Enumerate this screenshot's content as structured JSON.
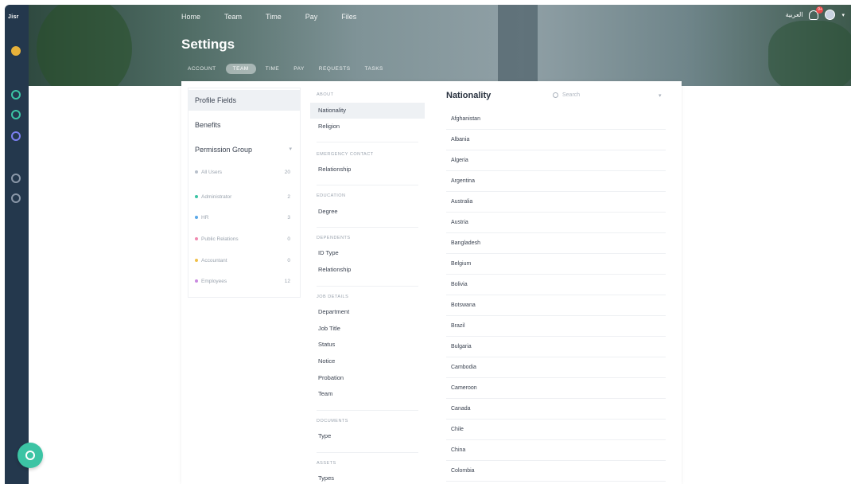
{
  "app": {
    "brand": "Jisr"
  },
  "topnav": [
    "Home",
    "Team",
    "Time",
    "Pay",
    "Files"
  ],
  "page_title": "Settings",
  "subtabs": [
    {
      "label": "ACCOUNT",
      "active": false
    },
    {
      "label": "TEAM",
      "active": true
    },
    {
      "label": "TIME",
      "active": false
    },
    {
      "label": "PAY",
      "active": false
    },
    {
      "label": "REQUESTS",
      "active": false
    },
    {
      "label": "TASKS",
      "active": false
    }
  ],
  "header_right": {
    "language": "العربية",
    "notif_count": "9+"
  },
  "left_menu": {
    "items": [
      "Profile Fields",
      "Benefits"
    ],
    "permission_group": "Permission Group",
    "groups": [
      {
        "name": "All Users",
        "count": "20",
        "color": "#b8c0cb"
      },
      {
        "name": "Administrator",
        "count": "2",
        "color": "#3cc4a4"
      },
      {
        "name": "HR",
        "count": "3",
        "color": "#5aa8e8"
      },
      {
        "name": "Public Relations",
        "count": "0",
        "color": "#f08ab0"
      },
      {
        "name": "Accountant",
        "count": "0",
        "color": "#f0c04a"
      },
      {
        "name": "Employees",
        "count": "12",
        "color": "#c98ae0"
      }
    ]
  },
  "fields": {
    "sections": [
      {
        "title": "ABOUT",
        "items": [
          "Nationality",
          "Religion"
        ]
      },
      {
        "title": "EMERGENCY CONTACT",
        "items": [
          "Relationship"
        ]
      },
      {
        "title": "EDUCATION",
        "items": [
          "Degree"
        ]
      },
      {
        "title": "DEPENDENTS",
        "items": [
          "ID Type",
          "Relationship"
        ]
      },
      {
        "title": "JOB DETAILS",
        "items": [
          "Department",
          "Job Title",
          "Status",
          "Notice",
          "Probation",
          "Team"
        ]
      },
      {
        "title": "DOCUMENTS",
        "items": [
          "Type"
        ]
      },
      {
        "title": "ASSETS",
        "items": [
          "Types"
        ]
      }
    ],
    "selected": "Nationality"
  },
  "nationality": {
    "title": "Nationality",
    "search_placeholder": "Search",
    "list": [
      "Afghanistan",
      "Albania",
      "Algeria",
      "Argentina",
      "Australia",
      "Austria",
      "Bangladesh",
      "Belgium",
      "Bolivia",
      "Botswana",
      "Brazil",
      "Bulgaria",
      "Cambodia",
      "Cameroon",
      "Canada",
      "Chile",
      "China",
      "Colombia"
    ]
  }
}
